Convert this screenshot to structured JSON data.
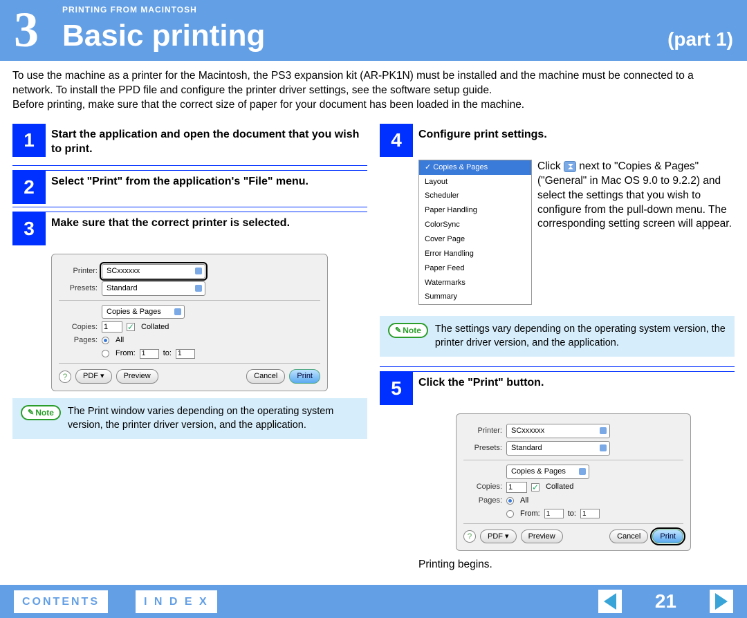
{
  "header": {
    "chapter_num": "3",
    "breadcrumb": "PRINTING FROM MACINTOSH",
    "title": "Basic printing",
    "part": "(part 1)"
  },
  "intro": "To use the machine as a printer for the Macintosh, the PS3 expansion kit (AR-PK1N) must be installed and the machine must be connected to a network. To install the PPD file and configure the printer driver settings, see the software setup guide.\nBefore printing, make sure that the correct size of paper for your document has been loaded in the machine.",
  "steps": {
    "s1": "Start the application and open the document that you wish to print.",
    "s2": "Select \"Print\" from the application's \"File\" menu.",
    "s3": "Make sure that the correct printer is selected.",
    "s4": "Configure print settings.",
    "s5": "Click the \"Print\" button."
  },
  "dialog_a": {
    "printer_label": "Printer:",
    "printer_value": "SCxxxxxx",
    "presets_label": "Presets:",
    "presets_value": "Standard",
    "pane_value": "Copies & Pages",
    "copies_label": "Copies:",
    "copies_value": "1",
    "collated": "Collated",
    "pages_label": "Pages:",
    "pages_all": "All",
    "pages_from": "From:",
    "pages_from_value": "1",
    "pages_to": "to:",
    "pages_to_value": "1",
    "help": "?",
    "pdf_btn": "PDF ▾",
    "preview_btn": "Preview",
    "cancel_btn": "Cancel",
    "print_btn": "Print"
  },
  "note_left": "The Print window varies depending on the operating system version, the printer driver version, and the application.",
  "note_right": "The settings vary depending on the operating system version, the printer driver version, and the application.",
  "note_label": "Note",
  "pane_list": [
    "Copies & Pages",
    "Layout",
    "Scheduler",
    "Paper Handling",
    "ColorSync",
    "Cover Page",
    "Error Handling",
    "Paper Feed",
    "Watermarks",
    "Summary"
  ],
  "step4_text_a": "Click ",
  "step4_text_b": " next to \"Copies & Pages\" (\"General\" in Mac OS 9.0 to 9.2.2) and select the settings that you wish to configure from the pull-down menu. The corresponding setting screen will appear.",
  "printing_begins": "Printing begins.",
  "footer": {
    "contents": "CONTENTS",
    "index": "I N D E X",
    "page": "21"
  }
}
